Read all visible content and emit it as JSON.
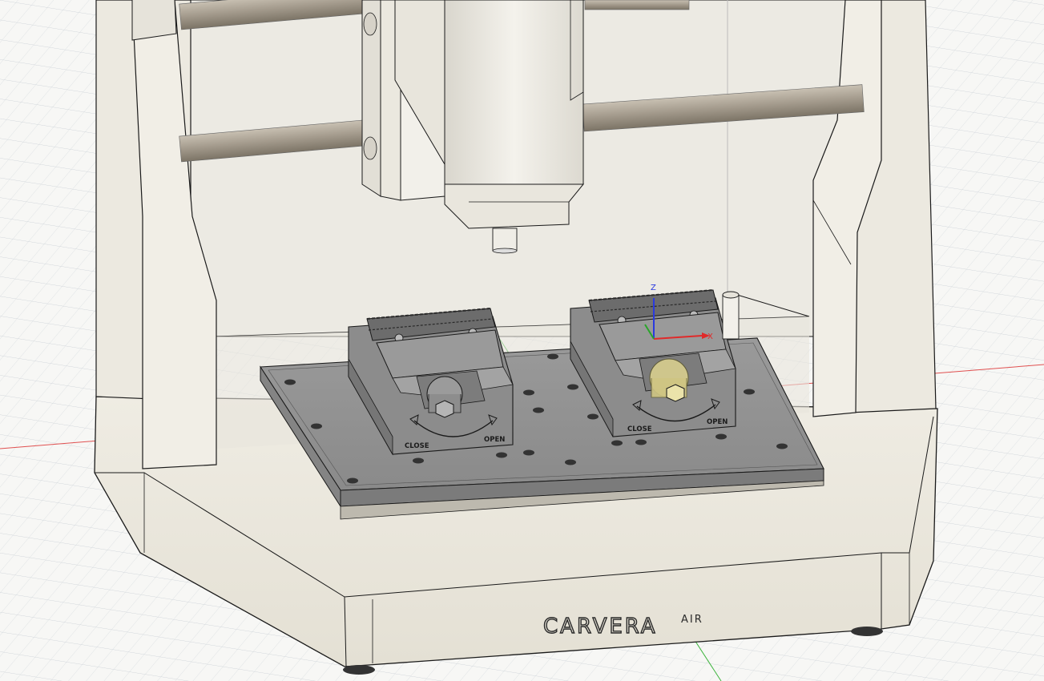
{
  "viewport": {
    "name": "3D model viewport",
    "background": "#f7f7f5",
    "grid_color": "#c6ccd2",
    "x_axis_color": "#e02a2a",
    "y_axis_color": "#2aa52a",
    "z_axis_color": "#2a3adf"
  },
  "model": {
    "brand_name": "CARVERA",
    "brand_suffix": "AIR",
    "body_color": "#eeebe2",
    "edge_color": "#1a1a1a",
    "rod_color": "#a39a8c",
    "fixture_color": "#8f8f8f",
    "fixture_dark": "#5a5a5a",
    "highlight_color": "#d8cf8e"
  },
  "vises": [
    {
      "close_label": "CLOSE",
      "open_label": "OPEN"
    },
    {
      "close_label": "CLOSE",
      "open_label": "OPEN"
    }
  ],
  "triad": {
    "x_label": "X",
    "z_label": "Z"
  }
}
